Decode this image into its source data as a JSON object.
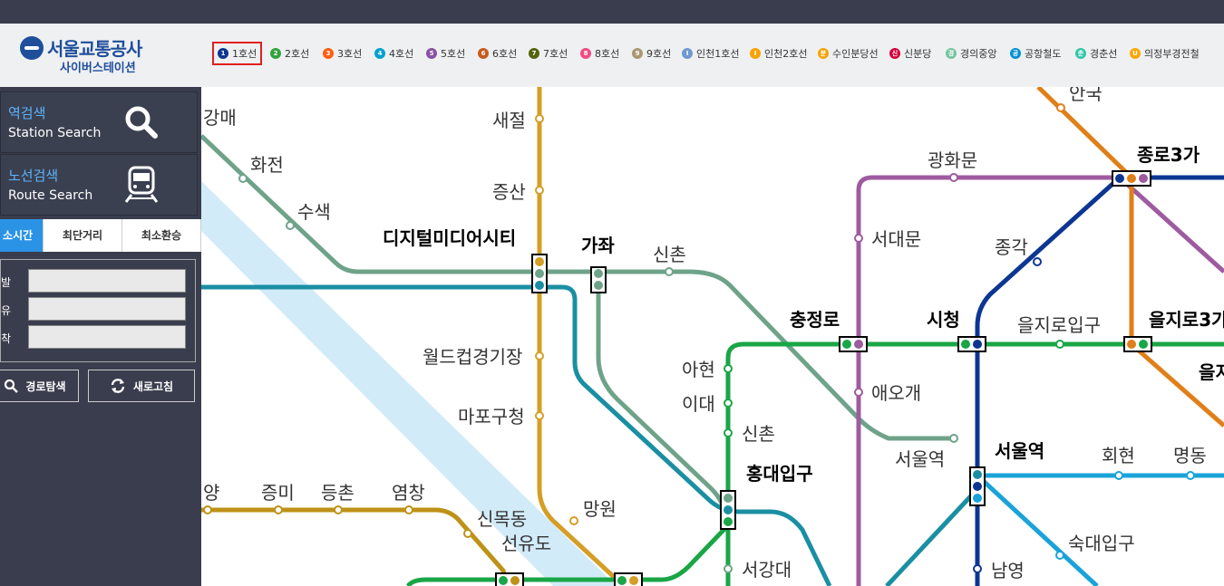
{
  "header": {
    "logo_title": "서울교통공사",
    "logo_sub": "사이버스테이션",
    "lines": [
      {
        "num": "1",
        "label": "1호선",
        "color": "#0d3692",
        "selected": true
      },
      {
        "num": "2",
        "label": "2호선",
        "color": "#33a23d"
      },
      {
        "num": "3",
        "label": "3호선",
        "color": "#fe5d10"
      },
      {
        "num": "4",
        "label": "4호선",
        "color": "#00a2d1"
      },
      {
        "num": "5",
        "label": "5호선",
        "color": "#8b50a4"
      },
      {
        "num": "6",
        "label": "6호선",
        "color": "#c55c1d"
      },
      {
        "num": "7",
        "label": "7호선",
        "color": "#54640d"
      },
      {
        "num": "8",
        "label": "8호선",
        "color": "#f14c82"
      },
      {
        "num": "9",
        "label": "9호선",
        "color": "#aa9872"
      },
      {
        "num": "I",
        "label": "인천1호선",
        "color": "#6f99d0"
      },
      {
        "num": "I",
        "label": "인천2호선",
        "color": "#f5a200"
      },
      {
        "num": "분",
        "label": "수인분당선",
        "color": "#f5a200"
      },
      {
        "num": "신",
        "label": "신분당",
        "color": "#d4003b"
      },
      {
        "num": "경",
        "label": "경의중앙",
        "color": "#77c4a3"
      },
      {
        "num": "공",
        "label": "공항철도",
        "color": "#0090d2"
      },
      {
        "num": "춘",
        "label": "경춘선",
        "color": "#32c6a6"
      },
      {
        "num": "U",
        "label": "의정부경전철",
        "color": "#fda600"
      }
    ]
  },
  "sidebar": {
    "station_search": {
      "ko": "역검색",
      "en": "Station Search"
    },
    "route_search": {
      "ko": "노선검색",
      "en": "Route Search"
    },
    "tabs": [
      "소시간",
      "최단거리",
      "최소환승"
    ],
    "fields": [
      {
        "label": "발"
      },
      {
        "label": "유"
      },
      {
        "label": "착"
      }
    ],
    "route_button": "경로탐색",
    "refresh_button": "새로고침"
  },
  "map": {
    "stations": {
      "gangmae": "강매",
      "hwajeon": "화전",
      "susaek": "수색",
      "dmc": "디지털미디어시티",
      "gajwa": "가좌",
      "saejeol": "새절",
      "jeungsan": "증산",
      "sinchon_gj": "신촌",
      "worldcup": "월드컵경기장",
      "mapo_gu": "마포구청",
      "ahyeon": "아현",
      "idae": "이대",
      "sinchon2": "신촌",
      "hongdae": "홍대입구",
      "mangwon": "망원",
      "seogang": "서강대",
      "chungjeongno": "충정로",
      "seodaemun": "서대문",
      "aeogae": "애오개",
      "gwanghwamun": "광화문",
      "jongno3": "종로3가",
      "jonggak": "종각",
      "cityhall": "시청",
      "euljiro1": "을지로입구",
      "euljiro3": "을지로3가",
      "seoulstn_gj": "서울역",
      "seoulstn": "서울역",
      "hoehyeon": "회현",
      "myeongdong": "명동",
      "sookmyung": "숙대입구",
      "namyeong": "남영",
      "anguk": "안국",
      "yang": "양",
      "jeungmi": "증미",
      "deungchon": "등촌",
      "yeomchang": "염창",
      "sinmokdong": "신목동",
      "seonyudo": "선유도",
      "eul2": "을지"
    }
  }
}
